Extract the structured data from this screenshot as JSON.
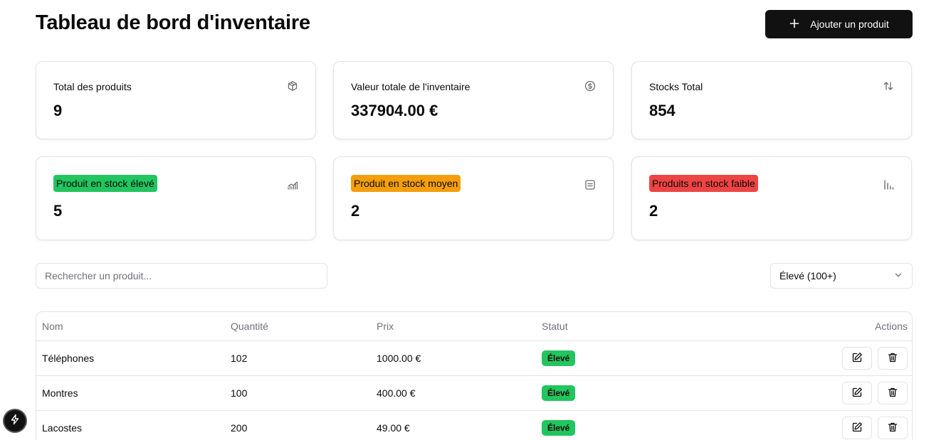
{
  "header": {
    "title": "Tableau de bord d'inventaire",
    "add_button_label": "Ajouter un produit"
  },
  "stats": [
    {
      "label": "Total des produits",
      "value": "9",
      "icon": "box-icon"
    },
    {
      "label": "Valeur totale de l'inventaire",
      "value": "337904.00 €",
      "icon": "dollar-circle-icon"
    },
    {
      "label": "Stocks Total",
      "value": "854",
      "icon": "arrows-up-down-icon"
    }
  ],
  "levels": [
    {
      "label": "Produit en stock élevé",
      "value": "5",
      "color": "#22c55e",
      "icon": "trending-up-chart-icon"
    },
    {
      "label": "Produit en stock moyen",
      "value": "2",
      "color": "#f59e0b",
      "icon": "list-icon"
    },
    {
      "label": "Produits en stock faible",
      "value": "2",
      "color": "#ef4444",
      "icon": "bar-chart-icon"
    }
  ],
  "search": {
    "placeholder": "Rechercher un produit..."
  },
  "filter": {
    "selected": "Élevé (100+)"
  },
  "table": {
    "headers": {
      "name": "Nom",
      "qty": "Quantité",
      "price": "Prix",
      "status": "Statut",
      "actions": "Actions"
    },
    "rows": [
      {
        "name": "Téléphones",
        "qty": "102",
        "price": "1000.00 €",
        "status": "Élevé"
      },
      {
        "name": "Montres",
        "qty": "100",
        "price": "400.00 €",
        "status": "Élevé"
      },
      {
        "name": "Lacostes",
        "qty": "200",
        "price": "49.00 €",
        "status": "Élevé"
      }
    ]
  },
  "colors": {
    "status_high": "#22c55e",
    "accent": "#111111"
  }
}
